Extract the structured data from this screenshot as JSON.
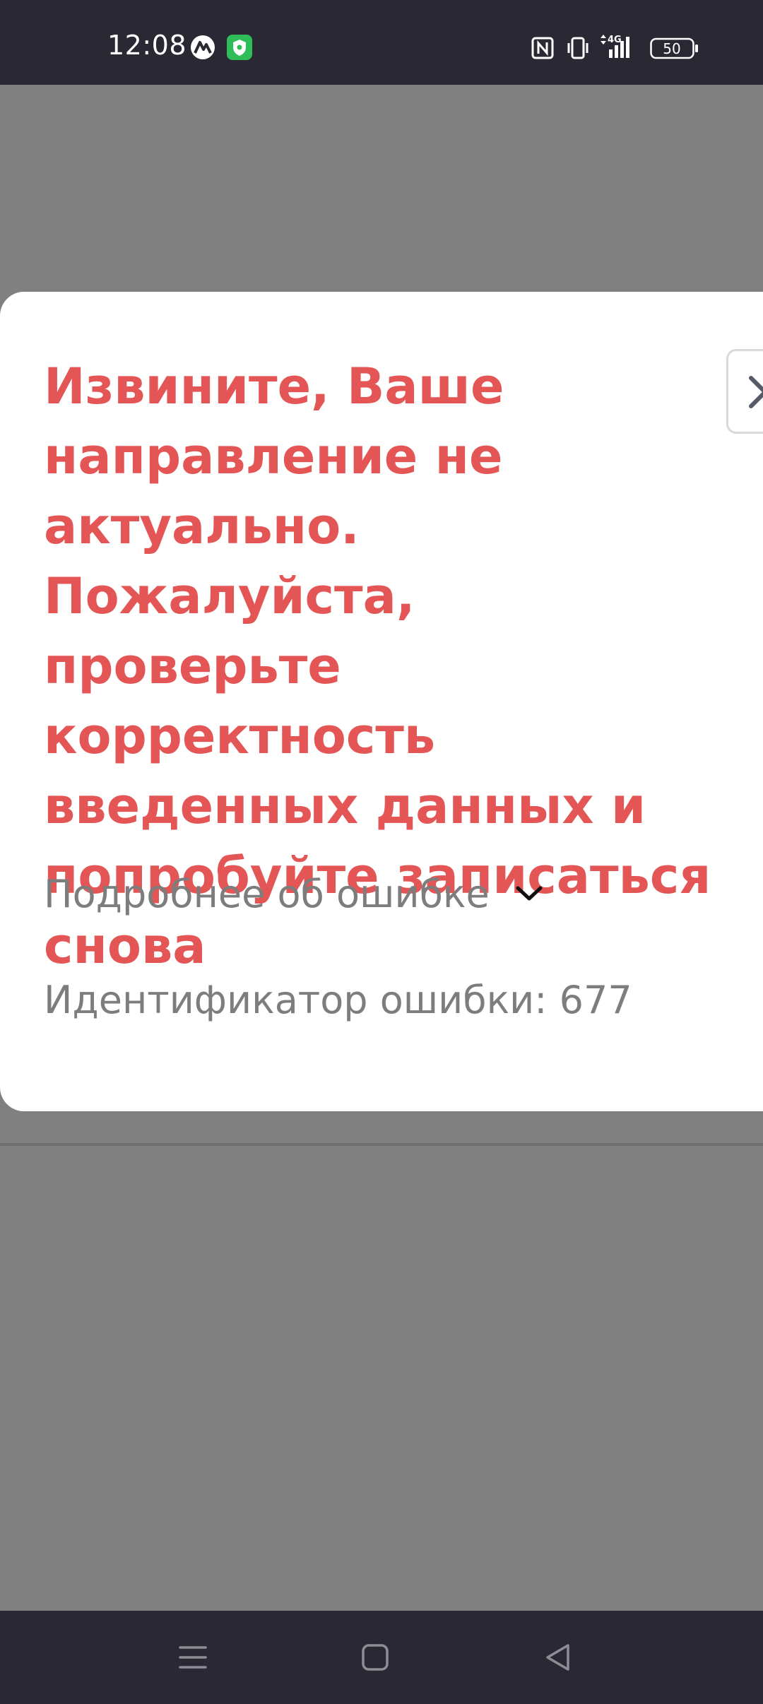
{
  "status_bar": {
    "time": "12:08",
    "battery": "50",
    "network": "4G",
    "icons": [
      "app-notification-icon",
      "shield-app-icon",
      "nfc-icon",
      "vibrate-icon",
      "signal-icon",
      "battery-icon"
    ]
  },
  "dialog": {
    "title": "Извините, Ваше направление не актуально. Пожалуйста, проверьте корректность введенных данных и попробуйте записаться снова",
    "details_label": "Подробнее об ошибке",
    "error_id": "Идентификатор ошибки: 677"
  },
  "colors": {
    "error_red": "#e45656",
    "muted_text": "#7d7d7d",
    "overlay": "#808080",
    "system_bar": "#2a2933"
  }
}
